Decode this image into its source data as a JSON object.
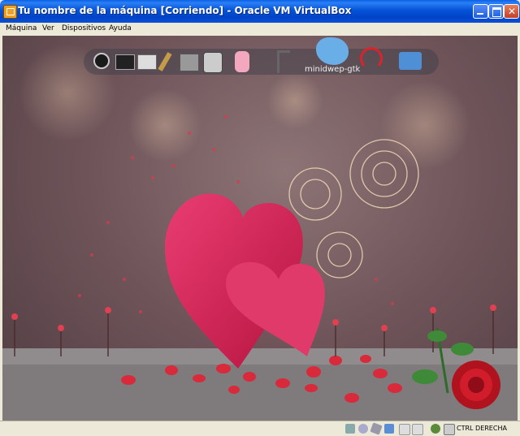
{
  "window": {
    "title": "Tu nombre de la máquina [Corriendo] - Oracle VM VirtualBox"
  },
  "menu": [
    "Máquina",
    "Ver",
    "Dispositivos",
    "Ayuda"
  ],
  "dock": {
    "items": [
      "power-icon",
      "terminal-icon",
      "terminal-icon-2",
      "paintbrush-icon",
      "calculator-icon",
      "disk-manager-icon",
      "baby-bottle-icon",
      "pump-icon",
      "minidwep-gtk-icon",
      "wireless-icon",
      "xfe-file-manager-icon"
    ],
    "hover_label": "minidwep-gtk"
  },
  "status": {
    "host_key": "CTRL DERECHA"
  },
  "colors": {
    "title_blue": "#0553d8",
    "heart_pink": "#d8245c"
  }
}
